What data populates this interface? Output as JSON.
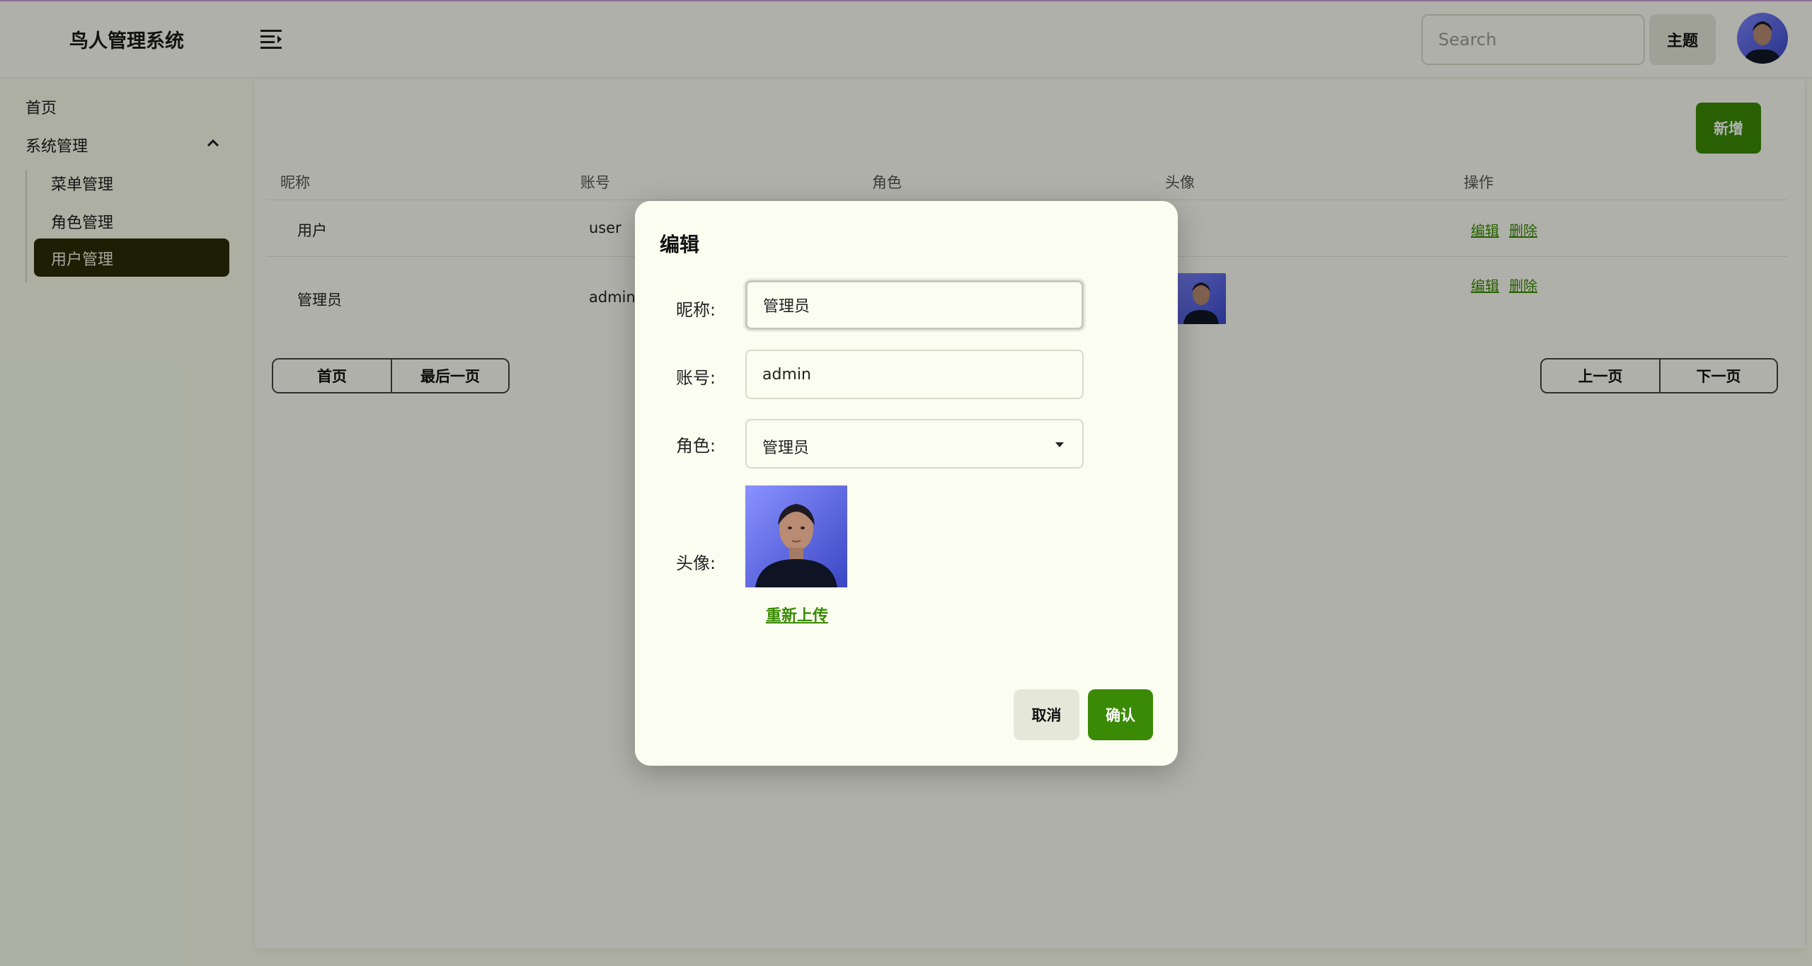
{
  "header": {
    "app_title": "鸟人管理系统",
    "search_placeholder": "Search",
    "theme_label": "主题"
  },
  "sidebar": {
    "home": "首页",
    "system": "系统管理",
    "items": [
      {
        "label": "菜单管理"
      },
      {
        "label": "角色管理"
      },
      {
        "label": "用户管理"
      }
    ]
  },
  "main": {
    "add_label": "新增",
    "columns": [
      "昵称",
      "账号",
      "角色",
      "头像",
      "操作"
    ],
    "rows": [
      {
        "nickname": "用户",
        "account": "user"
      },
      {
        "nickname": "管理员",
        "account": "admin"
      }
    ],
    "actions": {
      "edit": "编辑",
      "delete": "删除"
    },
    "pager_left": [
      "首页",
      "最后一页"
    ],
    "pager_right": [
      "上一页",
      "下一页"
    ]
  },
  "modal": {
    "title": "编辑",
    "nickname_label": "昵称:",
    "nickname_value": "管理员",
    "account_label": "账号:",
    "account_value": "admin",
    "role_label": "角色:",
    "role_value": "管理员",
    "avatar_label": "头像:",
    "reupload": "重新上传",
    "cancel": "取消",
    "confirm": "确认"
  },
  "colors": {
    "accent": "#3a8a05",
    "sidebar_active": "#2b2c07",
    "background": "#f7fbe9"
  }
}
